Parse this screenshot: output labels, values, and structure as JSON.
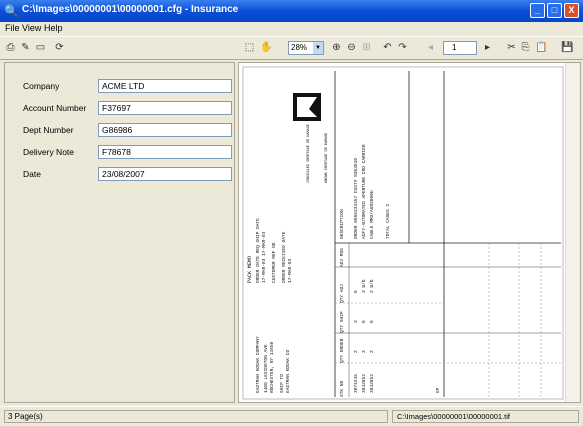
{
  "window": {
    "title": "C:\\Images\\00000001\\00000001.cfg - Insurance",
    "minimize_label": "_",
    "maximize_label": "□",
    "close_label": "X"
  },
  "menu": {
    "items": [
      "File",
      "View",
      "Help"
    ]
  },
  "toolbar": {
    "zoom_value": "28%",
    "page_number": "1"
  },
  "form": {
    "fields": [
      {
        "label": "Company",
        "value": "ACME LTD"
      },
      {
        "label": "Account Number",
        "value": "F37697"
      },
      {
        "label": "Dept Number",
        "value": "G86986"
      },
      {
        "label": "Delivery Note",
        "value": "F78678"
      },
      {
        "label": "Date",
        "value": "23/08/2007"
      }
    ]
  },
  "document": {
    "company": "EASTMAN KODAK COMPANY",
    "address1": "1400 LEXINGTON AVE",
    "city": "ROCHESTER, NY 14650",
    "ship_to": "SHIP TO",
    "ship_name": "EASTMAN KODAK CO",
    "heading": "PACK MEMO",
    "order_date": "ORDER DATE REQ SHIP DATE",
    "order_dates_value": "17-MAR-03  17-MAR-03",
    "customer_ref": "CUSTOMER REF NO",
    "order_received": "ORDER RECEIVED DATE",
    "order_received_value": "17-MAR-03",
    "known_shortage": "KNOWN SHORTAGE OR DAMAGE",
    "concealed_shortage": "CONCEALED SHORTAGE OR DAMAGE",
    "column_headers": [
      "STK NO",
      "QTY ORDER",
      "QTY SHIP",
      "QTY ADJ",
      "ADJ MSG",
      "DESCRIPTION"
    ],
    "rows": [
      {
        "stk": "3874245",
        "order": "2",
        "ship": "3",
        "adj": "0",
        "desc": "ORDER 0056233457 CUST# 8303510"
      },
      {
        "stk": "3842952",
        "order": "3",
        "ship": "0",
        "adj": "3 B/O",
        "desc": "ACF7-AUTOMATED APERTURE CRD CARRIER"
      },
      {
        "stk": "3842952",
        "order": "2",
        "ship": "0",
        "adj": "2 B/O",
        "desc": "CABLE MM2/A6R2000U"
      }
    ],
    "total": "TOTAL CASES 2",
    "gp": "GP"
  },
  "status": {
    "pages": "3 Page(s)",
    "path": "C:\\Images\\00000001\\00000001.tif"
  }
}
